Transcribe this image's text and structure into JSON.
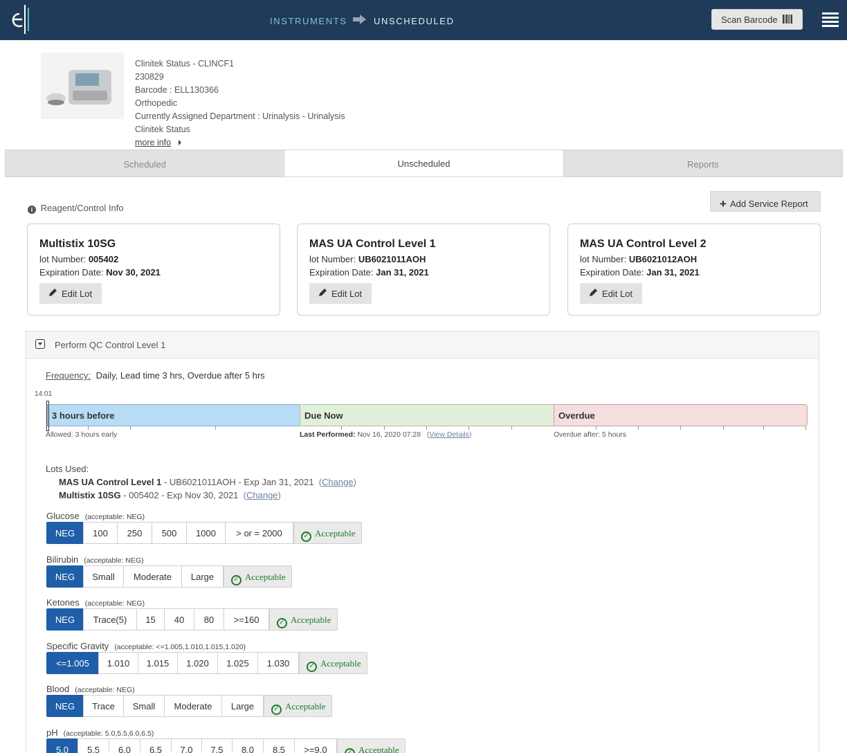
{
  "header": {
    "crumb_instruments": "INSTRUMENTS",
    "crumb_current": "UNSCHEDULED",
    "scan_label": "Scan Barcode"
  },
  "instrument": {
    "name": "Clinitek Status - CLINCF1",
    "serial": "230829",
    "barcode": "Barcode : ELL130366",
    "location": "Orthopedic",
    "department": "Currently Assigned Department : Urinalysis - Urinalysis",
    "model": "Clinitek Status",
    "more_info": "more info"
  },
  "tabs": [
    {
      "label": "Scheduled"
    },
    {
      "label": "Unscheduled"
    },
    {
      "label": "Reports"
    }
  ],
  "reagent_label": "Reagent/Control Info",
  "add_service_report": "Add Service Report",
  "lots": [
    {
      "name": "Multistix 10SG",
      "lot_label": "lot Number:",
      "lot": "005402",
      "exp_label": "Expiration Date:",
      "exp": "Nov 30, 2021",
      "edit": "Edit Lot"
    },
    {
      "name": "MAS UA Control Level 1",
      "lot_label": "lot Number:",
      "lot": "UB6021011AOH",
      "exp_label": "Expiration Date:",
      "exp": "Jan 31, 2021",
      "edit": "Edit Lot"
    },
    {
      "name": "MAS UA Control Level 2",
      "lot_label": "lot Number:",
      "lot": "UB6021012AOH",
      "exp_label": "Expiration Date:",
      "exp": "Jan 31, 2021",
      "edit": "Edit Lot"
    }
  ],
  "qc": {
    "title": "Perform QC Control Level 1",
    "frequency_label": "Frequency:",
    "frequency": "Daily, Lead time 3 hrs, Overdue after 5 hrs",
    "current_time": "14:01",
    "seg_before": "3 hours before",
    "seg_due": "Due Now",
    "seg_over": "Overdue",
    "allowed": "Allowed: 3 hours early",
    "last_performed_label": "Last Performed:",
    "last_performed": "Nov 16, 2020 07:28",
    "view_details": "View Details",
    "overdue_after": "Overdue after: 5 hours",
    "lots_used_label": "Lots Used:",
    "lots_used": [
      {
        "name": "MAS UA Control Level 1",
        "detail": " - UB6021011AOH - Exp Jan 31, 2021",
        "change": "Change"
      },
      {
        "name": "Multistix 10SG",
        "detail": " - 005402 - Exp Nov 30, 2021",
        "change": "Change"
      }
    ],
    "acceptable_label": "Acceptable",
    "analytes": [
      {
        "name": "Glucose",
        "acceptable": "(acceptable: NEG)",
        "options": [
          "NEG",
          "100",
          "250",
          "500",
          "1000",
          "> or = 2000"
        ],
        "selected": 0
      },
      {
        "name": "Bilirubin",
        "acceptable": "(acceptable: NEG)",
        "options": [
          "NEG",
          "Small",
          "Moderate",
          "Large"
        ],
        "selected": 0
      },
      {
        "name": "Ketones",
        "acceptable": "(acceptable: NEG)",
        "options": [
          "NEG",
          "Trace(5)",
          "15",
          "40",
          "80",
          ">=160"
        ],
        "selected": 0
      },
      {
        "name": "Specific Gravity",
        "acceptable": "(acceptable: <=1.005,1.010,1.015,1.020)",
        "options": [
          "<=1.005",
          "1.010",
          "1.015",
          "1.020",
          "1.025",
          "1.030"
        ],
        "selected": 0
      },
      {
        "name": "Blood",
        "acceptable": "(acceptable: NEG)",
        "options": [
          "NEG",
          "Trace",
          "Small",
          "Moderate",
          "Large"
        ],
        "selected": 0
      },
      {
        "name": "pH",
        "acceptable": "(acceptable: 5.0,5.5,6.0,6.5)",
        "options": [
          "5.0",
          "5.5",
          "6.0",
          "6.5",
          "7.0",
          "7.5",
          "8.0",
          "8.5",
          ">=9.0"
        ],
        "selected": 0
      }
    ]
  }
}
